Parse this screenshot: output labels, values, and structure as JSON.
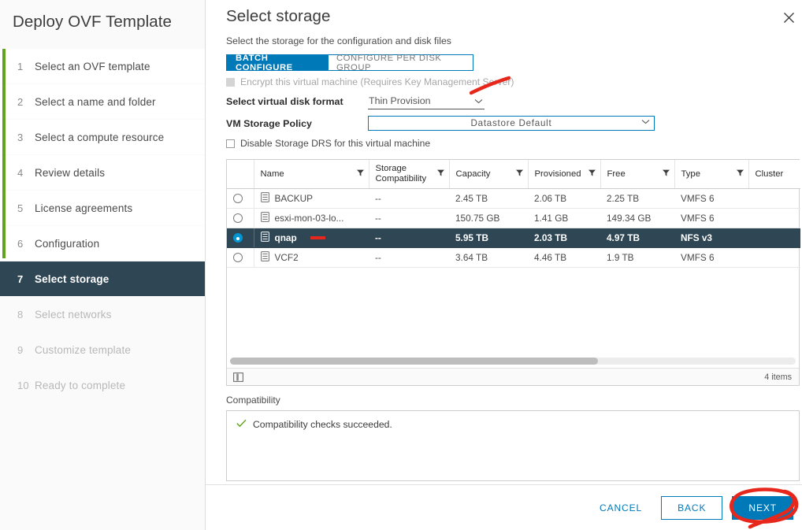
{
  "wizard": {
    "title": "Deploy OVF Template",
    "steps": [
      {
        "num": "1",
        "label": "Select an OVF template",
        "state": "done"
      },
      {
        "num": "2",
        "label": "Select a name and folder",
        "state": "done"
      },
      {
        "num": "3",
        "label": "Select a compute resource",
        "state": "done"
      },
      {
        "num": "4",
        "label": "Review details",
        "state": "done"
      },
      {
        "num": "5",
        "label": "License agreements",
        "state": "done"
      },
      {
        "num": "6",
        "label": "Configuration",
        "state": "done"
      },
      {
        "num": "7",
        "label": "Select storage",
        "state": "active"
      },
      {
        "num": "8",
        "label": "Select networks",
        "state": "future"
      },
      {
        "num": "9",
        "label": "Customize template",
        "state": "future"
      },
      {
        "num": "10",
        "label": "Ready to complete",
        "state": "future"
      }
    ]
  },
  "page": {
    "title": "Select storage",
    "subtitle": "Select the storage for the configuration and disk files",
    "close_label": "✕"
  },
  "tabs": {
    "batch_configure": "BATCH CONFIGURE",
    "configure_per_disk_group": "CONFIGURE PER DISK GROUP"
  },
  "form": {
    "encrypt_label": "Encrypt this virtual machine (Requires Key Management Server)",
    "disk_format_label": "Select virtual disk format",
    "disk_format_value": "Thin Provision",
    "storage_policy_label": "VM Storage Policy",
    "storage_policy_value": "Datastore Default",
    "disable_sdrs_label": "Disable Storage DRS for this virtual machine"
  },
  "table": {
    "columns": [
      {
        "label": "Name",
        "filter": true
      },
      {
        "label": "Storage Compatibility",
        "filter": true
      },
      {
        "label": "Capacity",
        "filter": true
      },
      {
        "label": "Provisioned",
        "filter": true
      },
      {
        "label": "Free",
        "filter": true
      },
      {
        "label": "Type",
        "filter": true
      },
      {
        "label": "Cluster",
        "filter": false
      }
    ],
    "rows": [
      {
        "selected": false,
        "name": "BACKUP",
        "compatibility": "--",
        "capacity": "2.45 TB",
        "provisioned": "2.06 TB",
        "free": "2.25 TB",
        "type": "VMFS 6",
        "cluster": ""
      },
      {
        "selected": false,
        "name": "esxi-mon-03-lo...",
        "compatibility": "--",
        "capacity": "150.75 GB",
        "provisioned": "1.41 GB",
        "free": "149.34 GB",
        "type": "VMFS 6",
        "cluster": ""
      },
      {
        "selected": true,
        "name": "qnap",
        "compatibility": "--",
        "capacity": "5.95 TB",
        "provisioned": "2.03 TB",
        "free": "4.97 TB",
        "type": "NFS v3",
        "cluster": ""
      },
      {
        "selected": false,
        "name": "VCF2",
        "compatibility": "--",
        "capacity": "3.64 TB",
        "provisioned": "4.46 TB",
        "free": "1.9 TB",
        "type": "VMFS 6",
        "cluster": ""
      }
    ],
    "item_count": "4 items"
  },
  "compatibility": {
    "label": "Compatibility",
    "message": "Compatibility checks succeeded."
  },
  "footer": {
    "cancel": "CANCEL",
    "back": "BACK",
    "next": "NEXT"
  },
  "colors": {
    "accent_blue": "#0079b8",
    "selected_row": "#2f4654",
    "progress_green": "#62a420",
    "annotation_red": "#e8271c",
    "radio_on": "#0095d3",
    "success_green": "#5aa315"
  }
}
